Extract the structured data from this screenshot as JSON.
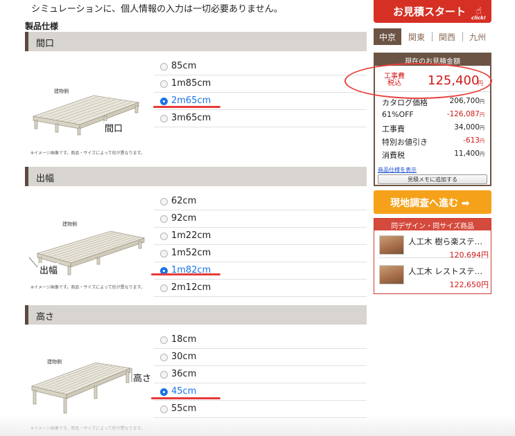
{
  "intro_text": "シミュレーションに、個人情報の入力は一切必要ありません。",
  "spec_title": "製品仕様",
  "image_note": "※イメージ画像です。商品・サイズによって形が異なります。",
  "building_side": "建物側",
  "sections": [
    {
      "title": "間口",
      "dim_label": "間口",
      "options": [
        {
          "label": "85cm",
          "selected": false
        },
        {
          "label": "1m85cm",
          "selected": false
        },
        {
          "label": "2m65cm",
          "selected": true
        },
        {
          "label": "3m65cm",
          "selected": false
        }
      ]
    },
    {
      "title": "出幅",
      "dim_label": "出幅",
      "options": [
        {
          "label": "62cm",
          "selected": false
        },
        {
          "label": "92cm",
          "selected": false
        },
        {
          "label": "1m22cm",
          "selected": false
        },
        {
          "label": "1m52cm",
          "selected": false
        },
        {
          "label": "1m82cm",
          "selected": true
        },
        {
          "label": "2m12cm",
          "selected": false
        }
      ]
    },
    {
      "title": "高さ",
      "dim_label": "高さ",
      "options": [
        {
          "label": "18cm",
          "selected": false
        },
        {
          "label": "30cm",
          "selected": false
        },
        {
          "label": "36cm",
          "selected": false
        },
        {
          "label": "45cm",
          "selected": true
        },
        {
          "label": "55cm",
          "selected": false
        }
      ]
    }
  ],
  "estimate_button": {
    "label": "お見積スタート",
    "click_text": "click!"
  },
  "regions": {
    "tabs": [
      "中京",
      "関東",
      "関西",
      "九州"
    ],
    "active": "中京"
  },
  "price_box": {
    "header": "現在のお見積金額",
    "total_label_line1": "工事費",
    "total_label_line2": "税込",
    "total_value": "125,400",
    "yen": "円",
    "rows": [
      {
        "label": "カタログ価格",
        "value": "206,700",
        "red": false
      },
      {
        "label": "61%OFF",
        "value": "-126,087",
        "red": true
      },
      {
        "label": "工事費",
        "value": "34,000",
        "red": false
      },
      {
        "label": "特別お値引き",
        "value": "-613",
        "red": true
      },
      {
        "label": "消費税",
        "value": "11,400",
        "red": false
      }
    ],
    "spec_link": "商品仕様を表示",
    "memo_button": "見積メモに追加する"
  },
  "survey_button": {
    "label": "現地調査へ進む ➡"
  },
  "same_design": {
    "header": "同デザイン・同サイズ商品",
    "products": [
      {
        "name": "人工木 樹ら楽ステージ",
        "price": "120,694円"
      },
      {
        "name": "人工木 レストステージ",
        "price": "122,650円"
      }
    ]
  },
  "colors": {
    "accent_red": "#d63024",
    "brown": "#6b5444",
    "orange": "#f5a21a",
    "link_blue": "#1a73e8"
  }
}
